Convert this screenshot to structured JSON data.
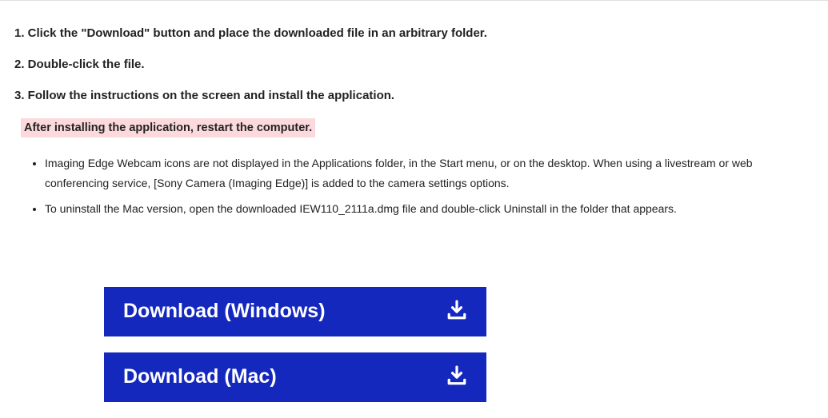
{
  "steps": [
    "1. Click the \"Download\" button and place the downloaded file in an arbitrary folder.",
    "2. Double-click the file.",
    "3. Follow the instructions on the screen and install the application."
  ],
  "restart_note": "After installing the application, restart the computer.",
  "bullets": [
    "Imaging Edge Webcam icons are not displayed in the Applications folder, in the Start menu, or on the desktop. When using a livestream or web conferencing service, [Sony Camera (Imaging Edge)] is added to the camera settings options.",
    "To uninstall the Mac version, open the downloaded IEW110_2111a.dmg file and double-click Uninstall in the folder that appears."
  ],
  "buttons": {
    "windows": "Download (Windows)",
    "mac": "Download (Mac)"
  }
}
